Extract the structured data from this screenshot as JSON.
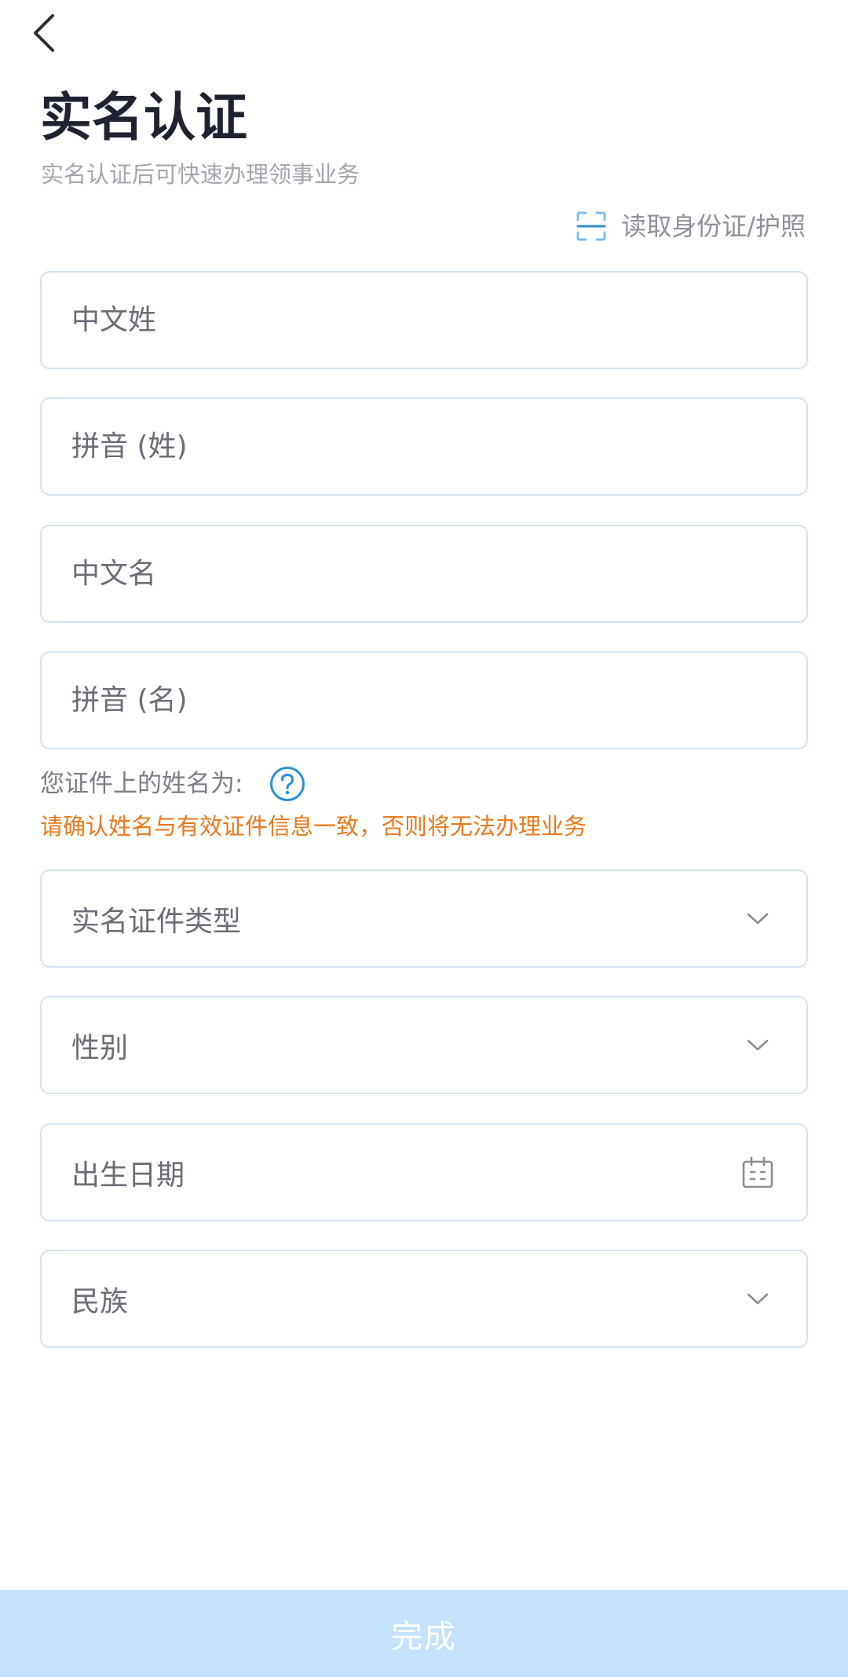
{
  "header": {
    "back_icon": "chevron-left-icon",
    "title": "实名认证",
    "subtitle": "实名认证后可快速办理领事业务"
  },
  "scan": {
    "icon": "scan-frame-icon",
    "label": "读取身份证/护照"
  },
  "name_fields": {
    "surname_cn": "中文姓",
    "surname_pinyin": "拼音 (姓)",
    "given_cn": "中文名",
    "given_pinyin": "拼音 (名)"
  },
  "name_hint": {
    "label": "您证件上的姓名为:",
    "help_icon": "question-circle-icon",
    "warning": "请确认姓名与有效证件信息一致，否则将无法办理业务"
  },
  "selects": {
    "id_type": "实名证件类型",
    "gender": "性别",
    "birth_date": "出生日期",
    "ethnicity": "民族"
  },
  "submit_label": "完成",
  "colors": {
    "accent": "#2b8fd6",
    "warning": "#e87a1d",
    "field_border": "#d2e3f3",
    "submit_bg_disabled": "#c4e2fb"
  }
}
